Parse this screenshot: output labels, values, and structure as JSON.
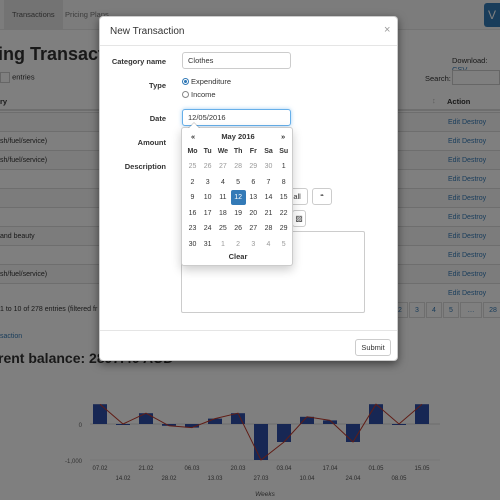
{
  "nav": {
    "tabs": [
      "Transactions",
      "Pricing Plans"
    ],
    "brand_letter": "V"
  },
  "page": {
    "title": "ing Transact",
    "entries_label": "entries",
    "download_label": "Download:",
    "download_csv": "CSV",
    "search_label": "Search:",
    "table_head": {
      "category": "ry",
      "action": "Action"
    },
    "rows": [
      {
        "category": "",
        "action": "Edit Destroy"
      },
      {
        "category": "sh/fuel/service)",
        "action": "Edit Destroy"
      },
      {
        "category": "sh/fuel/service)",
        "action": "Edit Destroy"
      },
      {
        "category": "",
        "action": "Edit Destroy"
      },
      {
        "category": "",
        "action": "Edit Destroy"
      },
      {
        "category": "",
        "action": "Edit Destroy"
      },
      {
        "category": "and beauty",
        "action": "Edit Destroy"
      },
      {
        "category": "",
        "action": "Edit Destroy"
      },
      {
        "category": "sh/fuel/service)",
        "action": "Edit Destroy"
      },
      {
        "category": "",
        "action": "Edit Destroy"
      }
    ],
    "table_info": "1 to 10 of 278 entries (filtered fr",
    "pagination": [
      "2",
      "3",
      "4",
      "5",
      "…",
      "28"
    ],
    "new_link": "saction",
    "balance": "rent balance: 2897.40 AUD"
  },
  "chart_data": {
    "type": "bar",
    "categories": [
      "07.02",
      "14.02",
      "21.02",
      "28.02",
      "06.03",
      "13.03",
      "20.03",
      "27.03",
      "03.04",
      "10.04",
      "17.04",
      "24.04",
      "01.05",
      "08.05",
      "15.05"
    ],
    "series": [
      {
        "values": [
          550,
          0,
          300,
          -50,
          -100,
          150,
          300,
          -1000,
          -500,
          200,
          100,
          -500,
          550,
          0,
          550
        ]
      }
    ],
    "y_ticks": [
      "0",
      "-1,000"
    ],
    "xlabel": "Weeks",
    "colors": {
      "bar": "#2f4fa8",
      "line": "#c0392b"
    }
  },
  "modal": {
    "title": "New Transaction",
    "close": "×",
    "category_label": "Category name",
    "category_value": "Clothes",
    "type_label": "Type",
    "type_options": [
      "Expenditure",
      "Income"
    ],
    "date_label": "Date",
    "date_value": "12/05/2016",
    "amount_label": "Amount",
    "description_label": "Description",
    "editor_small": "nall",
    "editor_quote": "“",
    "editor_image": "▨",
    "submit": "Submit"
  },
  "datepicker": {
    "prev": "«",
    "next": "»",
    "month": "May 2016",
    "dow": [
      "Mo",
      "Tu",
      "We",
      "Th",
      "Fr",
      "Sa",
      "Su"
    ],
    "weeks": [
      [
        "25",
        "26",
        "27",
        "28",
        "29",
        "30",
        "1"
      ],
      [
        "2",
        "3",
        "4",
        "5",
        "6",
        "7",
        "8"
      ],
      [
        "9",
        "10",
        "11",
        "12",
        "13",
        "14",
        "15"
      ],
      [
        "16",
        "17",
        "18",
        "19",
        "20",
        "21",
        "22"
      ],
      [
        "23",
        "24",
        "25",
        "26",
        "27",
        "28",
        "29"
      ],
      [
        "30",
        "31",
        "1",
        "2",
        "3",
        "4",
        "5"
      ]
    ],
    "selected": "12",
    "clear": "Clear"
  }
}
